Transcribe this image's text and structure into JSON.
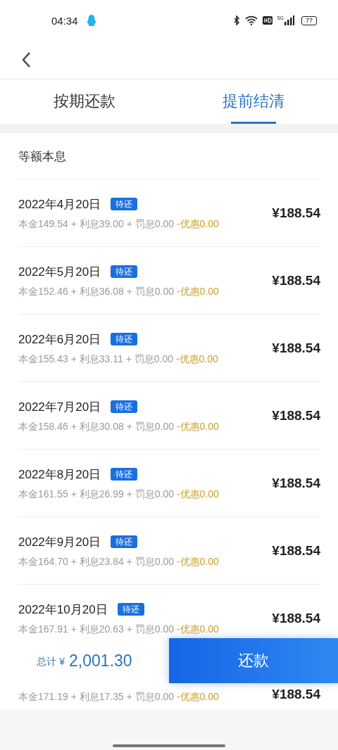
{
  "status_bar": {
    "time": "04:34",
    "network": "5G",
    "battery": "77"
  },
  "tabs": [
    {
      "label": "按期还款",
      "selected": false
    },
    {
      "label": "提前结清",
      "selected": true
    }
  ],
  "plan_title": "等额本息",
  "installments": [
    {
      "date": "2022年4月20日",
      "status": "待还",
      "breakdown": "本金149.54 + 利息39.00 + 罚息0.00",
      "discount": "-优惠0.00",
      "amount": "¥188.54"
    },
    {
      "date": "2022年5月20日",
      "status": "待还",
      "breakdown": "本金152.46 + 利息36.08 + 罚息0.00",
      "discount": "-优惠0.00",
      "amount": "¥188.54"
    },
    {
      "date": "2022年6月20日",
      "status": "待还",
      "breakdown": "本金155.43 + 利息33.11 + 罚息0.00",
      "discount": "-优惠0.00",
      "amount": "¥188.54"
    },
    {
      "date": "2022年7月20日",
      "status": "待还",
      "breakdown": "本金158.46 + 利息30.08 + 罚息0.00",
      "discount": "-优惠0.00",
      "amount": "¥188.54"
    },
    {
      "date": "2022年8月20日",
      "status": "待还",
      "breakdown": "本金161.55 + 利息26.99 + 罚息0.00",
      "discount": "-优惠0.00",
      "amount": "¥188.54"
    },
    {
      "date": "2022年9月20日",
      "status": "待还",
      "breakdown": "本金164.70 + 利息23.84 + 罚息0.00",
      "discount": "-优惠0.00",
      "amount": "¥188.54"
    },
    {
      "date": "2022年10月20日",
      "status": "待还",
      "breakdown": "本金167.91 + 利息20.63 + 罚息0.00",
      "discount": "-优惠0.00",
      "amount": "¥188.54"
    },
    {
      "breakdown": "本金171.19 + 利息17.35 + 罚息0.00",
      "discount": "-优惠0.00",
      "amount": "¥188.54"
    }
  ],
  "footer": {
    "total_label": "总计 ¥",
    "total": "2,001.30",
    "pay_button": "还款"
  }
}
